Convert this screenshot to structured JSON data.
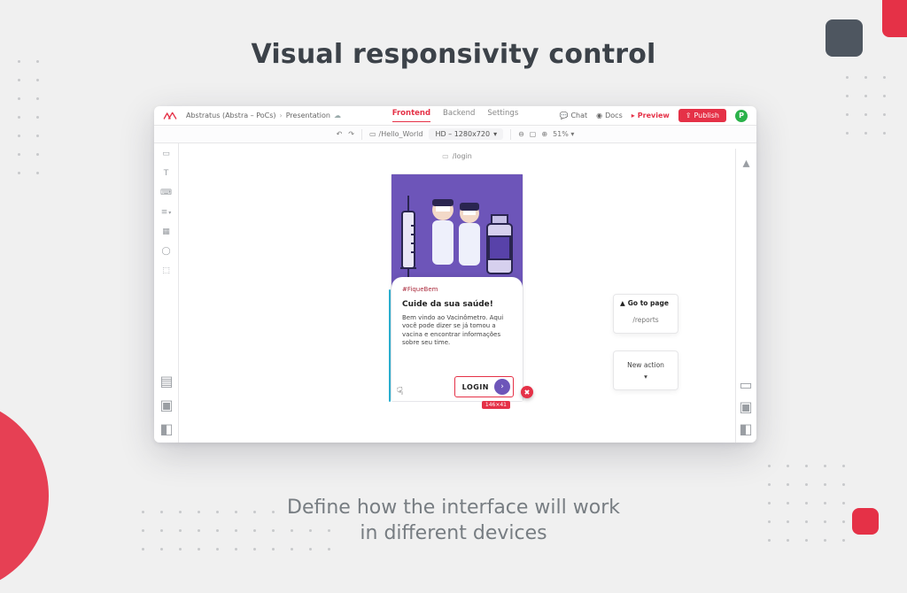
{
  "hero": {
    "title": "Visual responsivity control",
    "subtitle_line1": "Define how the interface will work",
    "subtitle_line2": "in different devices"
  },
  "breadcrumbs": {
    "project": "Abstratus (Abstra – PoCs)",
    "page": "Presentation"
  },
  "nav": {
    "frontend": "Frontend",
    "backend": "Backend",
    "settings": "Settings"
  },
  "top_actions": {
    "chat": "Chat",
    "docs": "Docs",
    "preview": "Preview",
    "publish": "Publish",
    "avatar_initial": "P"
  },
  "subbar": {
    "route": "/Hello_World",
    "resolution": "HD – 1280x720",
    "zoom": "51%"
  },
  "canvas": {
    "page_label": "/login"
  },
  "mock": {
    "hashtag": "#FiqueBem",
    "heading": "Cuide da sua saúde!",
    "body": "Bem vindo ao Vacinômetro. Aqui você pode dizer se já tomou a vacina e encontrar informações sobre seu time.",
    "login": "LOGIN",
    "size_badge": "146×41"
  },
  "panels": {
    "goto_title": "Go to page",
    "goto_value": "/reports",
    "new_action": "New action"
  },
  "colors": {
    "accent": "#e53147",
    "purple": "#6d55b9"
  }
}
